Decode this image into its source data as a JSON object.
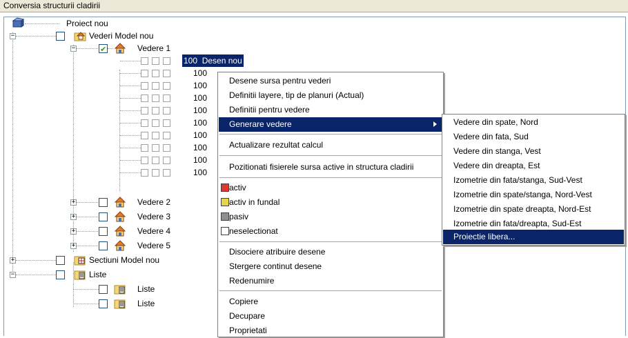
{
  "window": {
    "title": "Conversia structurii cladirii"
  },
  "tree": {
    "root": {
      "label": "Proiect nou"
    },
    "views_model": {
      "label": "Vederi Model nou"
    },
    "view1": {
      "label": "Vedere 1",
      "checked": true
    },
    "drawings": [
      {
        "number": "100",
        "name": "Desen nou"
      },
      {
        "number": "100"
      },
      {
        "number": "100"
      },
      {
        "number": "100"
      },
      {
        "number": "100"
      },
      {
        "number": "100"
      },
      {
        "number": "100"
      },
      {
        "number": "100"
      },
      {
        "number": "100"
      },
      {
        "number": "100"
      }
    ],
    "views": [
      "Vedere 2",
      "Vedere 3",
      "Vedere 4",
      "Vedere 5"
    ],
    "sections": {
      "label": "Sectiuni Model nou"
    },
    "lists": {
      "label": "Liste",
      "children": [
        "Liste",
        "Liste"
      ]
    }
  },
  "context_menu": {
    "items": [
      "Desene sursa pentru vederi",
      "Definitii layere, tip de planuri (Actual)",
      "Definitii pentru vedere",
      "Generare vedere",
      "Actualizare rezultat calcul",
      "Pozitionati fisierele sursa active in structura cladirii",
      "activ",
      "activ in fundal",
      "pasiv",
      "neselectionat",
      "Disociere atribuire desene",
      "Stergere continut desene",
      "Redenumire",
      "Copiere",
      "Decupare",
      "Proprietati"
    ],
    "status_colors": {
      "activ": "#e03a2e",
      "activ_in_fundal": "#e8d44a",
      "pasiv": "#909090",
      "neselectionat": "#ffffff"
    }
  },
  "submenu": {
    "items": [
      "Vedere din spate, Nord",
      "Vedere din fata, Sud",
      "Vedere din stanga, Vest",
      "Vedere din dreapta, Est",
      "Izometrie din fata/stanga, Sud-Vest",
      "Izometrie din spate/stanga, Nord-Vest",
      "Izometrie din spate dreapta, Nord-Est",
      "Izometrie din fata/dreapta, Sud-Est",
      "Proiectie libera..."
    ]
  },
  "colors": {
    "selection": "#0a246a",
    "panel_border": "#7f9db9",
    "title_bg": "#ece9d8"
  }
}
